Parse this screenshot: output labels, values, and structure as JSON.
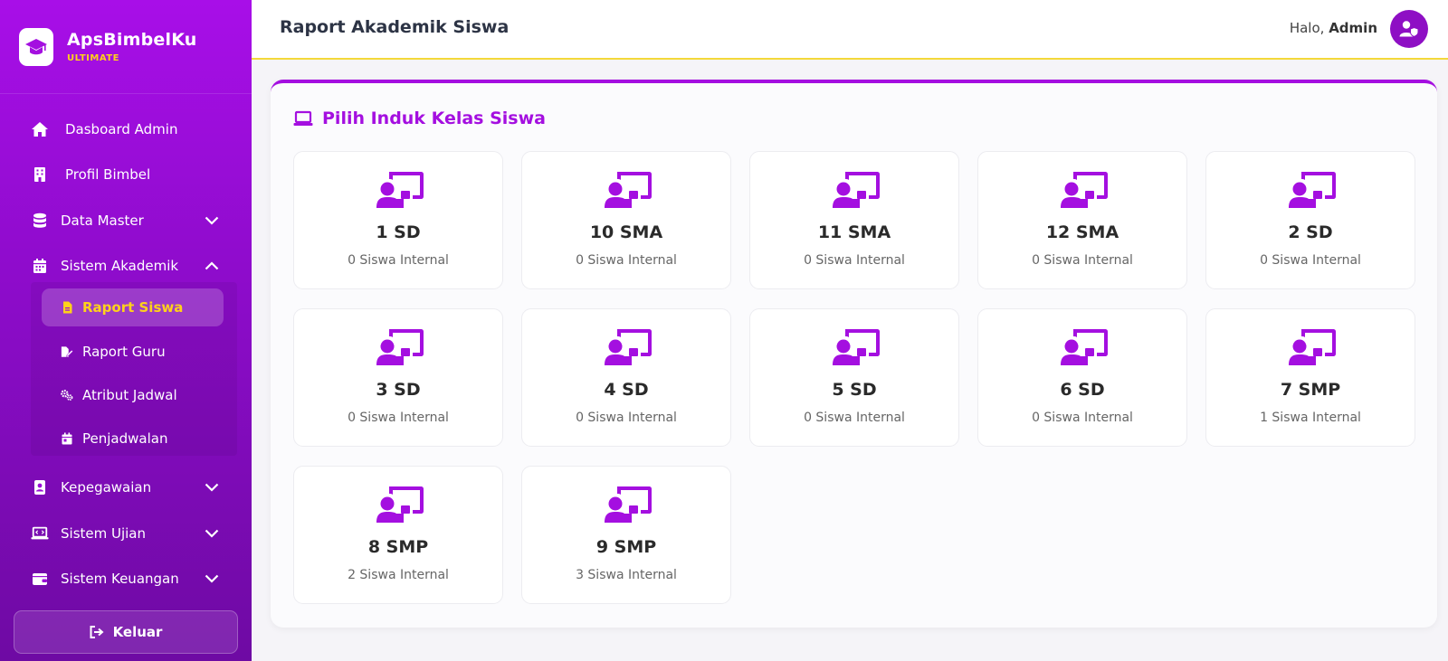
{
  "brand": {
    "name": "ApsBimbelKu",
    "edition": "ULTIMATE"
  },
  "colors": {
    "accent": "#a40fe0",
    "highlight": "#ffd21a",
    "sidebar_top": "#a80ee8",
    "sidebar_bottom": "#6e0aa3"
  },
  "sidebar": {
    "items": [
      {
        "label": "Dasboard Admin",
        "icon": "home-icon"
      },
      {
        "label": "Profil Bimbel",
        "icon": "building-icon"
      },
      {
        "label": "Data Master",
        "icon": "database-icon",
        "expandable": true
      },
      {
        "label": "Sistem Akademik",
        "icon": "calendar-icon",
        "expanded": true
      },
      {
        "label": "Kepegawaian",
        "icon": "id-badge-icon",
        "expandable": true
      },
      {
        "label": "Sistem Ujian",
        "icon": "laptop-code-icon",
        "expandable": true
      },
      {
        "label": "Sistem Keuangan",
        "icon": "wallet-icon",
        "expandable": true
      }
    ],
    "subitems": [
      {
        "label": "Raport Siswa",
        "icon": "file-icon",
        "active": true
      },
      {
        "label": "Raport Guru",
        "icon": "file-signature-icon"
      },
      {
        "label": "Atribut Jadwal",
        "icon": "cogs-icon"
      },
      {
        "label": "Penjadwalan",
        "icon": "calendar-day-icon"
      }
    ],
    "logout_label": "Keluar"
  },
  "header": {
    "title": "Raport Akademik Siswa",
    "greeting": "Halo,",
    "user": "Admin"
  },
  "panel": {
    "title": "Pilih Induk Kelas Siswa",
    "classes": [
      {
        "name": "1 SD",
        "count": "0 Siswa Internal"
      },
      {
        "name": "10 SMA",
        "count": "0 Siswa Internal"
      },
      {
        "name": "11 SMA",
        "count": "0 Siswa Internal"
      },
      {
        "name": "12 SMA",
        "count": "0 Siswa Internal"
      },
      {
        "name": "2 SD",
        "count": "0 Siswa Internal"
      },
      {
        "name": "3 SD",
        "count": "0 Siswa Internal"
      },
      {
        "name": "4 SD",
        "count": "0 Siswa Internal"
      },
      {
        "name": "5 SD",
        "count": "0 Siswa Internal"
      },
      {
        "name": "6 SD",
        "count": "0 Siswa Internal"
      },
      {
        "name": "7 SMP",
        "count": "1 Siswa Internal"
      },
      {
        "name": "8 SMP",
        "count": "2 Siswa Internal"
      },
      {
        "name": "9 SMP",
        "count": "3 Siswa Internal"
      }
    ]
  }
}
